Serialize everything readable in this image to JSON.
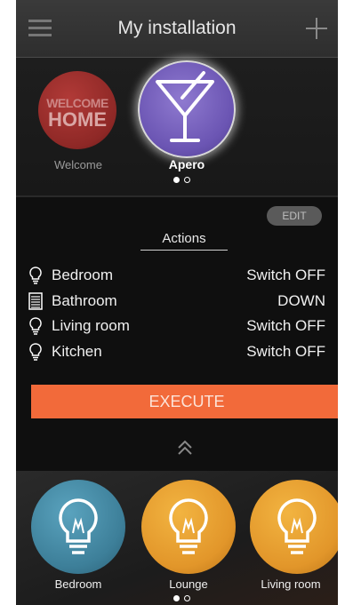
{
  "header": {
    "title": "My installation",
    "menu_icon": "hamburger-menu-icon",
    "add_icon": "plus-icon"
  },
  "scenarios": {
    "items": [
      {
        "label": "Welcome",
        "badge_line1": "WELCOME",
        "badge_line2": "HOME",
        "color": "#9b2f2d"
      },
      {
        "label": "Apero",
        "icon": "cocktail-glass-icon",
        "color": "#6f5bb8",
        "selected": true
      }
    ],
    "page_index": 0,
    "page_count": 2
  },
  "actions": {
    "edit_label": "EDIT",
    "title": "Actions",
    "rows": [
      {
        "icon": "bulb-icon",
        "name": "Bedroom",
        "value": "Switch OFF"
      },
      {
        "icon": "shutter-icon",
        "name": "Bathroom",
        "value": "DOWN"
      },
      {
        "icon": "bulb-icon",
        "name": "Living room",
        "value": "Switch OFF"
      },
      {
        "icon": "bulb-icon",
        "name": "Kitchen",
        "value": "Switch OFF"
      }
    ],
    "execute_label": "EXECUTE",
    "expand_icon": "double-chevron-up-icon",
    "accent": "#f26a3a"
  },
  "devices": {
    "items": [
      {
        "label": "Bedroom",
        "icon": "bulb-icon",
        "color": "#4a8fab"
      },
      {
        "label": "Lounge",
        "icon": "bulb-icon",
        "color": "#e89b2e"
      },
      {
        "label": "Living room",
        "icon": "bulb-icon",
        "color": "#e89b2e"
      }
    ],
    "page_index": 0,
    "page_count": 2
  }
}
